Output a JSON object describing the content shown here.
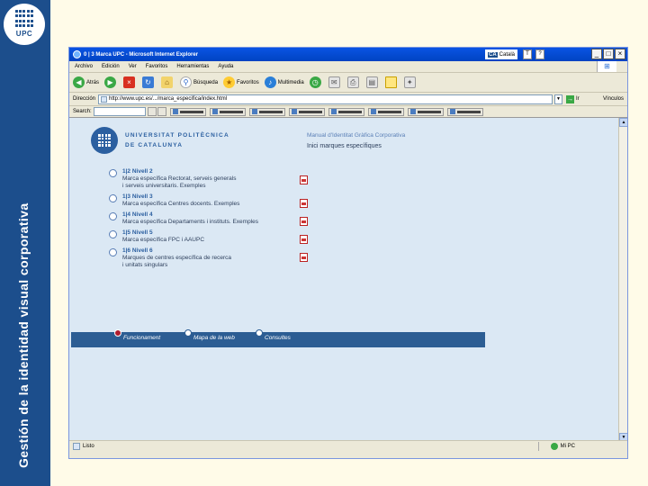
{
  "slide": {
    "vertical_title": "Gestión de la identidad visual corporativa",
    "logo_text": "UPC"
  },
  "browser": {
    "title": "0 | 3 Marca UPC - Microsoft Internet Explorer",
    "ca_badge": "CA",
    "ca_label": "Català",
    "win_buttons": [
      "_",
      "□",
      "×"
    ],
    "menu": [
      "Archivo",
      "Edición",
      "Ver",
      "Favoritos",
      "Herramientas",
      "Ayuda"
    ],
    "toolbar": {
      "back": "Atrás",
      "search": "Búsqueda",
      "favorites": "Favoritos",
      "multimedia": "Multimedia"
    },
    "address": {
      "label": "Dirección",
      "value": "http://www.upc.es/.../marca_especifica/index.html",
      "go_label": "Ir",
      "links_label": "Vínculos"
    },
    "search_label": "Search:",
    "status": {
      "text": "Listo",
      "zone": "Mi PC"
    }
  },
  "content": {
    "logo_line1": "UNIVERSITAT POLITÈCNICA",
    "logo_line2": "DE CATALUNYA",
    "manual_title": "Manual d'Identitat Gràfica Corporativa",
    "manual_subtitle": "Inici marques específiques",
    "items": [
      {
        "code": "1|2 Nivell 2",
        "lines": [
          "Marca específica Rectorat, serveis generals",
          "i serveis universitaris. Exemples"
        ]
      },
      {
        "code": "1|3 Nivell 3",
        "lines": [
          "Marca específica Centres docents. Exemples"
        ]
      },
      {
        "code": "1|4 Nivell 4",
        "lines": [
          "Marca específica Departaments i instituts. Exemples"
        ]
      },
      {
        "code": "1|5 Nivell 5",
        "lines": [
          "Marca específica FPC i AAUPC"
        ]
      },
      {
        "code": "1|6 Nivell 6",
        "lines": [
          "Marques de centres específica de recerca",
          "i unitats singulars"
        ]
      }
    ],
    "bottom_nav": [
      "Funcionament",
      "Mapa de la web",
      "Consultes"
    ]
  },
  "colors": {
    "sidebar": "#1c4e8c",
    "page_background": "#dbe8f4",
    "nav_bar": "#2c5d93",
    "active_dot": "#b01c2e"
  }
}
